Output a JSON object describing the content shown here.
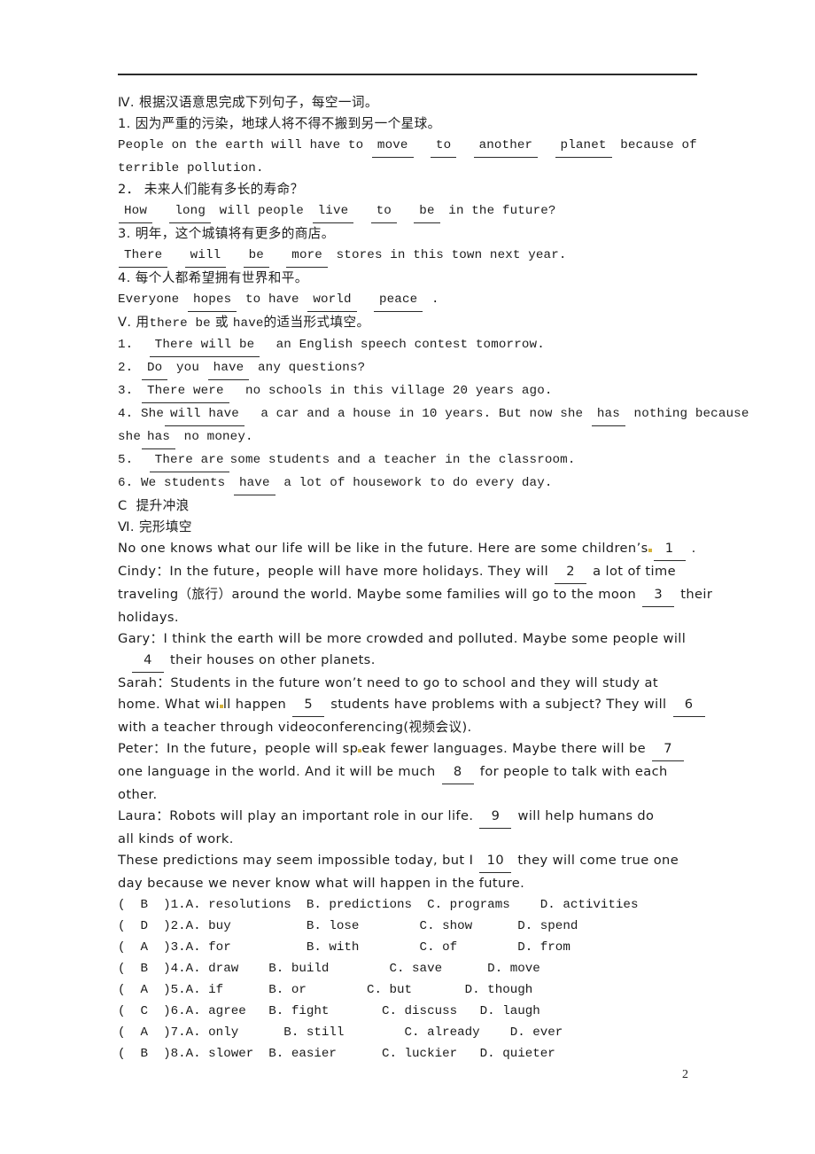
{
  "page": {
    "number": "2",
    "has_header_rule": true
  },
  "section_iv": {
    "heading": "Ⅳ. 根据汉语意思完成下列句子，每空一词。",
    "items": [
      {
        "num": "1.",
        "chinese": "因为严重的污染，地球人将不得不搬到另一个星球。",
        "english_pre": "People on the earth will have to",
        "answers": [
          "move",
          "to",
          "another",
          "planet"
        ],
        "english_post": "because of",
        "english_wrap": "terrible pollution."
      },
      {
        "num": "2．",
        "chinese": "未来人们能有多长的寿命？",
        "lead_answers": [
          "How",
          "long"
        ],
        "mid_text": "will people",
        "mid_answers": [
          "live",
          "to",
          "be"
        ],
        "tail_text": "in the future?"
      },
      {
        "num": "3.",
        "chinese": "明年，这个城镇将有更多的商店。",
        "lead_answers": [
          "There",
          "will",
          "be",
          "more"
        ],
        "tail_text": "stores in this town next year."
      },
      {
        "num": "4.",
        "chinese": "每个人都希望拥有世界和平。",
        "english_pre": "Everyone",
        "answers": [
          "hopes"
        ],
        "mid_text": "to have",
        "mid_answers": [
          "world",
          "peace"
        ],
        "tail_text": "."
      }
    ]
  },
  "section_v": {
    "heading_prefix": "Ⅴ. 用",
    "heading_rom1": "there be",
    "heading_mid": "或",
    "heading_rom2": "have",
    "heading_suffix": "的适当形式填空。",
    "items": [
      {
        "num": "1.",
        "answer": "There will be",
        "rest": "an English speech contest tomorrow."
      },
      {
        "num": "2.",
        "answer": "Do",
        "mid": "you",
        "answer2": "have",
        "rest": "any questions?"
      },
      {
        "num": "3.",
        "answer": "There were",
        "rest": "no schools in this village 20 years ago."
      },
      {
        "num": "4.",
        "pre": "She",
        "answer": "will have",
        "rest": "a car and a house in 10 years. But now she",
        "answer2": "has",
        "rest2": "nothing because",
        "wrap_pre": "she",
        "wrap_answer": "has",
        "wrap_rest": "no money."
      },
      {
        "num": "5.",
        "answer": "There are",
        "rest": "some students and a teacher in the classroom."
      },
      {
        "num": "6.",
        "pre": "We students",
        "answer": "have",
        "rest": "a lot of housework to do every day."
      }
    ]
  },
  "section_c": {
    "label": "C",
    "title": "提升冲浪"
  },
  "section_vi": {
    "heading": "Ⅵ. 完形填空",
    "passage": [
      {
        "type": "mixed",
        "parts": [
          {
            "t": "text",
            "v": "No one knows what our life will be like in the future. Here are some children’s"
          },
          {
            "t": "mark"
          },
          {
            "t": "blank",
            "v": "1"
          },
          {
            "t": "text",
            "v": "."
          }
        ]
      },
      {
        "type": "mixed",
        "parts": [
          {
            "t": "text",
            "v": "Cindy：In the future，people will have more holidays. They will"
          },
          {
            "t": "blank",
            "v": "2"
          },
          {
            "t": "text",
            "v": "a lot of time"
          }
        ]
      },
      {
        "type": "mixed",
        "parts": [
          {
            "t": "text",
            "v": "traveling（旅行）around the world. Maybe some families will go to the moon"
          },
          {
            "t": "blank",
            "v": "3"
          },
          {
            "t": "text",
            "v": "their"
          }
        ]
      },
      {
        "type": "plain",
        "v": "holidays."
      },
      {
        "type": "plain",
        "v": "Gary：I think the earth will be more crowded and polluted. Maybe some people will"
      },
      {
        "type": "mixed",
        "indent": true,
        "parts": [
          {
            "t": "blank",
            "v": "4"
          },
          {
            "t": "text",
            "v": "their houses on other planets."
          }
        ]
      },
      {
        "type": "plain",
        "v": "Sarah：Students in the future won’t need to go to school and they will study at"
      },
      {
        "type": "mixed",
        "parts": [
          {
            "t": "text",
            "v": "home. What wi"
          },
          {
            "t": "mark"
          },
          {
            "t": "text",
            "v": "ll happen"
          },
          {
            "t": "blank",
            "v": "5"
          },
          {
            "t": "text",
            "v": "students have problems with a subject? They will"
          },
          {
            "t": "blank",
            "v": "6"
          }
        ]
      },
      {
        "type": "plain",
        "v": "with a teacher through videoconferencing(视频会议)."
      },
      {
        "type": "mixed",
        "parts": [
          {
            "t": "text",
            "v": "Peter：In the future，people will sp"
          },
          {
            "t": "mark"
          },
          {
            "t": "text",
            "v": "eak fewer languages. Maybe there will be"
          },
          {
            "t": "blank",
            "v": "7"
          }
        ]
      },
      {
        "type": "mixed",
        "parts": [
          {
            "t": "text",
            "v": "one language in the world. And it will be much"
          },
          {
            "t": "blank",
            "v": "8"
          },
          {
            "t": "text",
            "v": "for people to talk with each"
          }
        ]
      },
      {
        "type": "plain",
        "v": "other."
      },
      {
        "type": "mixed",
        "parts": [
          {
            "t": "text",
            "v": "Laura：Robots will play an important role in our life."
          },
          {
            "t": "blank",
            "v": "9"
          },
          {
            "t": "text",
            "v": "will help humans do"
          }
        ]
      },
      {
        "type": "plain",
        "v": "all kinds of work."
      },
      {
        "type": "mixed",
        "parts": [
          {
            "t": "text",
            "v": "These predictions may seem impossible today, but I"
          },
          {
            "t": "blank",
            "v": "10"
          },
          {
            "t": "text",
            "v": "they will come true one"
          }
        ]
      },
      {
        "type": "plain",
        "v": "day because we never know what will happen in the future."
      }
    ],
    "choices": [
      {
        "answer": "B",
        "num": "1.",
        "raw": "(  B  )1.A. resolutions  B. predictions  C. programs    D. activities"
      },
      {
        "answer": "D",
        "num": "2.",
        "raw": "(  D  )2.A. buy          B. lose        C. show      D. spend"
      },
      {
        "answer": "A",
        "num": "3.",
        "raw": "(  A  )3.A. for          B. with        C. of        D. from"
      },
      {
        "answer": "B",
        "num": "4.",
        "raw": "(  B  )4.A. draw    B. build        C. save      D. move"
      },
      {
        "answer": "A",
        "num": "5.",
        "raw": "(  A  )5.A. if      B. or        C. but       D. though"
      },
      {
        "answer": "C",
        "num": "6.",
        "raw": "(  C  )6.A. agree   B. fight       C. discuss   D. laugh"
      },
      {
        "answer": "A",
        "num": "7.",
        "raw": "(  A  )7.A. only      B. still        C. already    D. ever"
      },
      {
        "answer": "B",
        "num": "8.",
        "raw": "(  B  )8.A. slower  B. easier      C. luckier   D. quieter"
      }
    ]
  }
}
